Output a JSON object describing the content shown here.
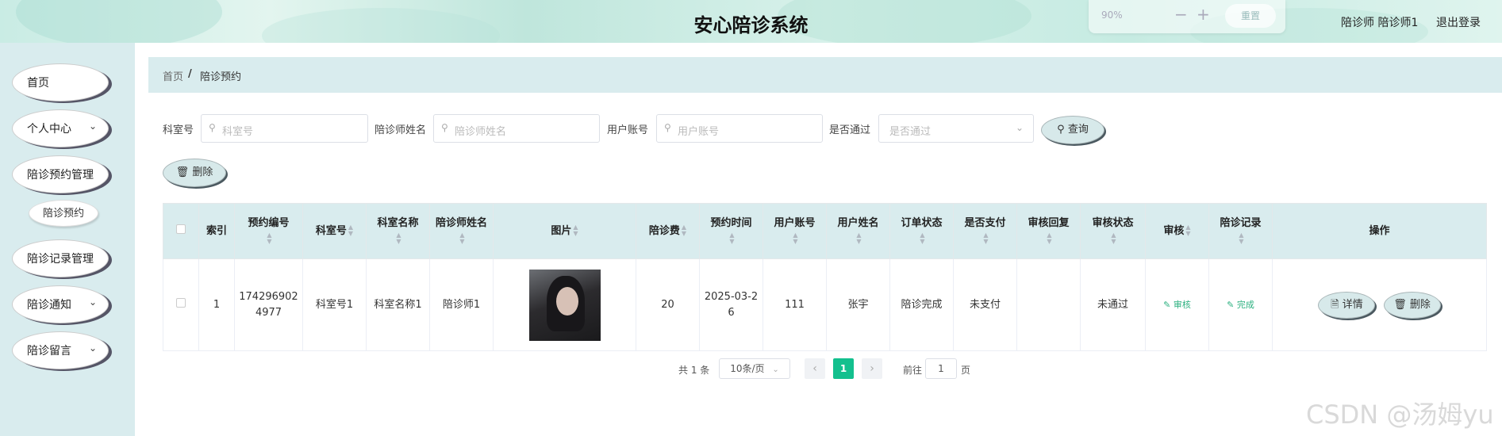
{
  "header": {
    "title": "安心陪诊系统",
    "zoom_value": "90%",
    "zoom_out": "−",
    "zoom_in": "+",
    "reset_label": "重置",
    "user": "陪诊师 陪诊师1",
    "logout": "退出登录"
  },
  "sidebar": {
    "items": [
      {
        "label": "首页"
      },
      {
        "label": "个人中心"
      },
      {
        "label": "陪诊预约管理"
      },
      {
        "label": "陪诊预约"
      },
      {
        "label": "陪诊记录管理"
      },
      {
        "label": "陪诊通知"
      },
      {
        "label": "陪诊留言"
      }
    ]
  },
  "breadcrumb": {
    "home": "首页",
    "sep": "/",
    "current": "陪诊预约"
  },
  "search": {
    "room_label": "科室号",
    "room_placeholder": "科室号",
    "escort_label": "陪诊师姓名",
    "escort_placeholder": "陪诊师姓名",
    "account_label": "用户账号",
    "account_placeholder": "用户账号",
    "passed_label": "是否通过",
    "passed_placeholder": "是否通过",
    "query_label": "查询",
    "delete_label": "删除"
  },
  "table": {
    "headers": [
      "索引",
      "预约编号",
      "科室号",
      "科室名称",
      "陪诊师姓名",
      "图片",
      "陪诊费",
      "预约时间",
      "用户账号",
      "用户姓名",
      "订单状态",
      "是否支付",
      "审核回复",
      "审核状态",
      "审核",
      "陪诊记录",
      "操作"
    ],
    "row": {
      "index": "1",
      "order_no": "1742969024977",
      "room_no": "科室号1",
      "room_name": "科室名称1",
      "escort": "陪诊师1",
      "fee": "20",
      "time": "2025-03-26",
      "account": "111",
      "name": "张宇",
      "order_status": "陪诊完成",
      "paid": "未支付",
      "reply": "",
      "review_status": "未通过",
      "review_link": "审核",
      "record_link": "完成",
      "detail_btn": "详情",
      "delete_btn": "删除"
    }
  },
  "pagination": {
    "total": "共 1 条",
    "page_size": "10条/页",
    "current": "1",
    "goto_label": "前往",
    "goto_value": "1",
    "page_suffix": "页"
  },
  "watermark": "CSDN @汤姆yu"
}
